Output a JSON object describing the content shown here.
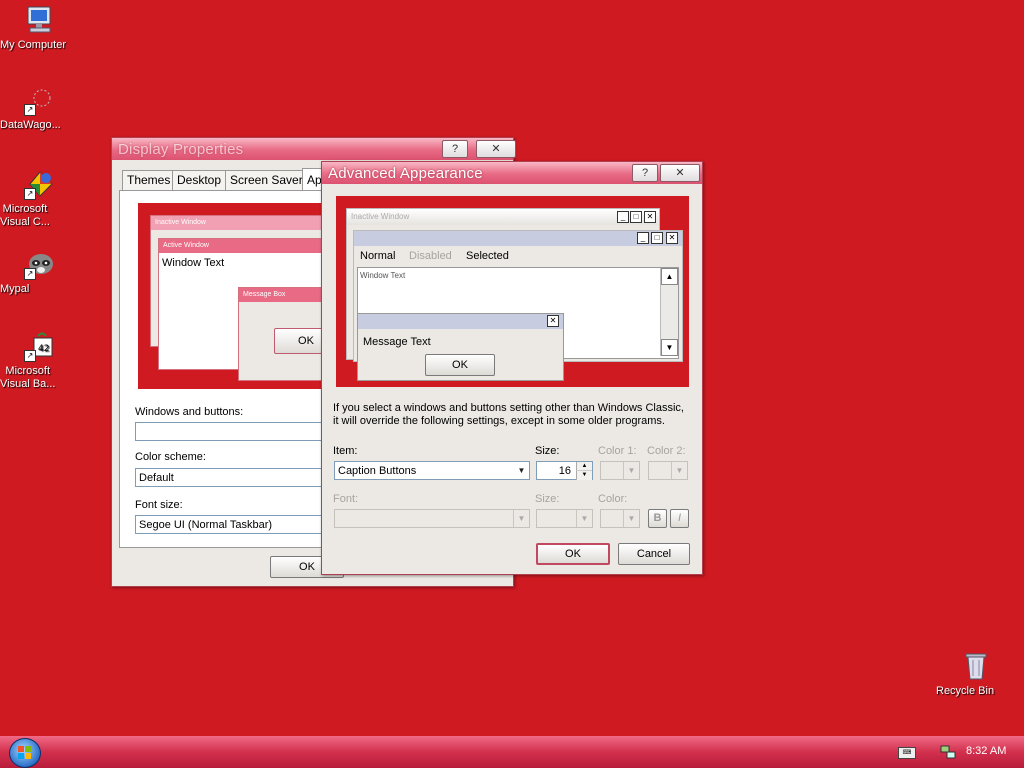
{
  "desktop": {
    "icons": [
      {
        "label": "My Computer"
      },
      {
        "label": "DataWago..."
      },
      {
        "label": "Microsoft Visual C..."
      },
      {
        "label": "Mypal"
      },
      {
        "label": "Microsoft Visual Ba..."
      },
      {
        "label": "Recycle Bin"
      }
    ]
  },
  "display_properties": {
    "title": "Display Properties",
    "tabs": [
      "Themes",
      "Desktop",
      "Screen Saver",
      "Ap"
    ],
    "preview": {
      "inactive_window": "Inactive Window",
      "active_window": "Active Window",
      "window_text": "Window Text",
      "message_box": "Message Box",
      "ok": "OK"
    },
    "windows_and_buttons_label": "Windows and buttons:",
    "windows_and_buttons_value": "",
    "color_scheme_label": "Color scheme:",
    "color_scheme_value": "Default",
    "font_size_label": "Font size:",
    "font_size_value": "Segoe UI (Normal Taskbar)",
    "ok_label": "OK"
  },
  "advanced_appearance": {
    "title": "Advanced Appearance",
    "preview": {
      "inactive_window": "Inactive Window",
      "menu_normal": "Normal",
      "menu_disabled": "Disabled",
      "menu_selected": "Selected",
      "window_text": "Window Text",
      "message_text": "Message Text",
      "ok": "OK"
    },
    "info_text_1": "If you select a windows and buttons setting other than Windows Classic,",
    "info_text_2": "it will override the following settings, except in some older programs.",
    "item_label": "Item:",
    "item_value": "Caption Buttons",
    "size_label": "Size:",
    "size_value": "16",
    "color1_label": "Color 1:",
    "color2_label": "Color 2:",
    "font_label": "Font:",
    "font_size_label": "Size:",
    "font_color_label": "Color:",
    "bold_label": "B",
    "italic_label": "I",
    "ok_label": "OK",
    "cancel_label": "Cancel"
  },
  "taskbar": {
    "clock": "8:32 AM"
  },
  "colors": {
    "desktop_bg": "#d01a22",
    "accent": "#e86a84",
    "taskbar": "#d2304d"
  }
}
